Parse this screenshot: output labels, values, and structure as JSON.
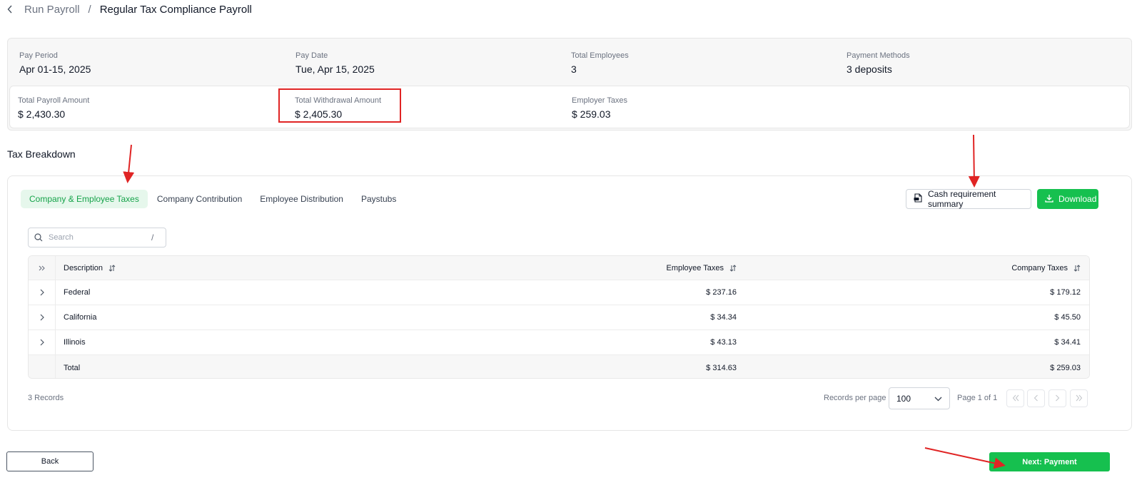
{
  "breadcrumb": {
    "parent": "Run Payroll",
    "separator": "/",
    "current": "Regular Tax Compliance Payroll"
  },
  "summary": {
    "pay_period": {
      "label": "Pay Period",
      "value": "Apr 01-15, 2025"
    },
    "pay_date": {
      "label": "Pay Date",
      "value": "Tue, Apr 15, 2025"
    },
    "total_employees": {
      "label": "Total Employees",
      "value": "3"
    },
    "payment_methods": {
      "label": "Payment Methods",
      "value": "3 deposits"
    },
    "total_payroll": {
      "label": "Total Payroll Amount",
      "value": "$ 2,430.30"
    },
    "total_withdrawal": {
      "label": "Total Withdrawal Amount",
      "value": "$ 2,405.30"
    },
    "employer_taxes": {
      "label": "Employer Taxes",
      "value": "$ 259.03"
    }
  },
  "section_title": "Tax Breakdown",
  "tabs": [
    {
      "label": "Company & Employee Taxes",
      "active": true
    },
    {
      "label": "Company Contribution",
      "active": false
    },
    {
      "label": "Employee Distribution",
      "active": false
    },
    {
      "label": "Paystubs",
      "active": false
    }
  ],
  "actions": {
    "cash_summary_label": "Cash requirement summary",
    "download_label": "Download"
  },
  "search": {
    "placeholder": "Search",
    "shortcut": "/"
  },
  "table": {
    "headers": {
      "description": "Description",
      "employee_taxes": "Employee Taxes",
      "company_taxes": "Company Taxes"
    },
    "rows": [
      {
        "description": "Federal",
        "employee_taxes": "$ 237.16",
        "company_taxes": "$ 179.12"
      },
      {
        "description": "California",
        "employee_taxes": "$ 34.34",
        "company_taxes": "$ 45.50"
      },
      {
        "description": "Illinois",
        "employee_taxes": "$ 43.13",
        "company_taxes": "$ 34.41"
      }
    ],
    "total": {
      "description": "Total",
      "employee_taxes": "$ 314.63",
      "company_taxes": "$ 259.03"
    }
  },
  "pagination": {
    "records_count": "3 Records",
    "records_per_page_label": "Records per page",
    "records_per_page": "100",
    "page_info": "Page 1 of 1"
  },
  "footer": {
    "back_label": "Back",
    "next_label": "Next: Payment"
  },
  "colors": {
    "accent_green": "#16c04f",
    "annotation_red": "#e02424",
    "active_tab_bg": "#e6f7ec"
  }
}
